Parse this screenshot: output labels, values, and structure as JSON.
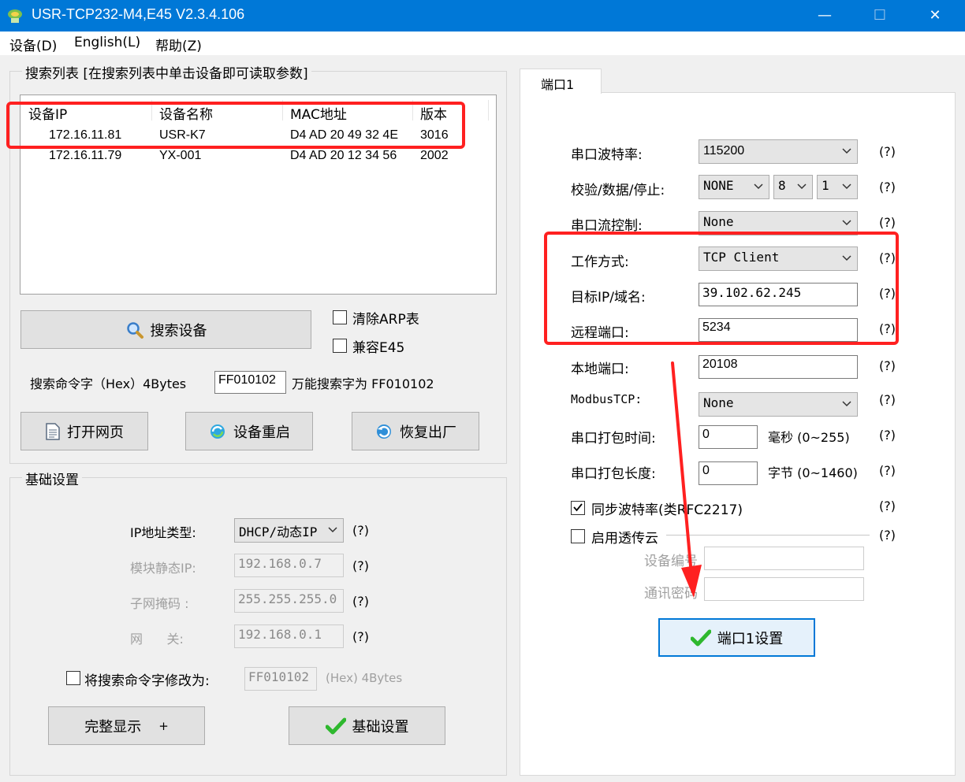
{
  "window": {
    "title": "USR-TCP232-M4,E45 V2.3.4.106",
    "minimize": "—",
    "maximize": "☐",
    "close": "✕"
  },
  "menu": [
    "设备(D)",
    "English(L)",
    "帮助(Z)"
  ],
  "search_group": {
    "title": "搜索列表 [在搜索列表中单击设备即可读取参数]",
    "columns": [
      "设备IP",
      "设备名称",
      "MAC地址",
      "版本"
    ],
    "rows": [
      [
        "172.16.11.81",
        "USR-K7",
        "D4 AD 20 49 32 4E",
        "3016"
      ],
      [
        "172.16.11.79",
        "YX-001",
        "D4 AD 20 12 34 56",
        "2002"
      ]
    ],
    "search_button": "搜索设备",
    "clear_arp": "清除ARP表",
    "compat_e45": "兼容E45",
    "cmd_label": "搜索命令字（Hex）4Bytes",
    "cmd_value": "FF010102",
    "cmd_hint": "万能搜索字为 FF010102",
    "open_web": "打开网页",
    "restart": "设备重启",
    "factory": "恢复出厂"
  },
  "basic_group": {
    "title": "基础设置",
    "ip_type_label": "IP地址类型:",
    "ip_type_value": "DHCP/动态IP",
    "static_ip_label": "模块静态IP:",
    "static_ip_value": "192.168.0.7",
    "subnet_label": "子网掩码 :",
    "subnet_value": "255.255.255.0",
    "gateway_label": "网      关:",
    "gateway_value": "192.168.0.1",
    "modify_cmd_label": "将搜索命令字修改为:",
    "modify_cmd_value": "FF010102",
    "modify_cmd_unit": "(Hex) 4Bytes",
    "full_display": "完整显示",
    "full_display_plus": "+",
    "basic_set_button": "基础设置",
    "help": "(?)"
  },
  "port_tab": {
    "tab_label": "端口1",
    "baud_label": "串口波特率:",
    "baud_value": "115200",
    "parity_label": "校验/数据/停止:",
    "parity_value": "NONE",
    "data_value": "8",
    "stop_value": "1",
    "flow_label": "串口流控制:",
    "flow_value": "None",
    "mode_label": "工作方式:",
    "mode_value": "TCP Client",
    "target_label": "目标IP/域名:",
    "target_value": "39.102.62.245",
    "remote_port_label": "远程端口:",
    "remote_port_value": "5234",
    "local_port_label": "本地端口:",
    "local_port_value": "20108",
    "modbus_label": "ModbusTCP:",
    "modbus_value": "None",
    "pack_time_label": "串口打包时间:",
    "pack_time_value": "0",
    "pack_time_unit": "毫秒 (0~255)",
    "pack_len_label": "串口打包长度:",
    "pack_len_value": "0",
    "pack_len_unit": "字节 (0~1460)",
    "sync_baud_label": "同步波特率(类RFC2217)",
    "cloud_label": "启用透传云",
    "device_no_label": "设备编号",
    "comm_pwd_label": "通讯密码",
    "port_set_button": "端口1设置",
    "help": "(?)"
  },
  "colors": {
    "titlebar": "#0078d7",
    "annotation": "#ff2020"
  }
}
